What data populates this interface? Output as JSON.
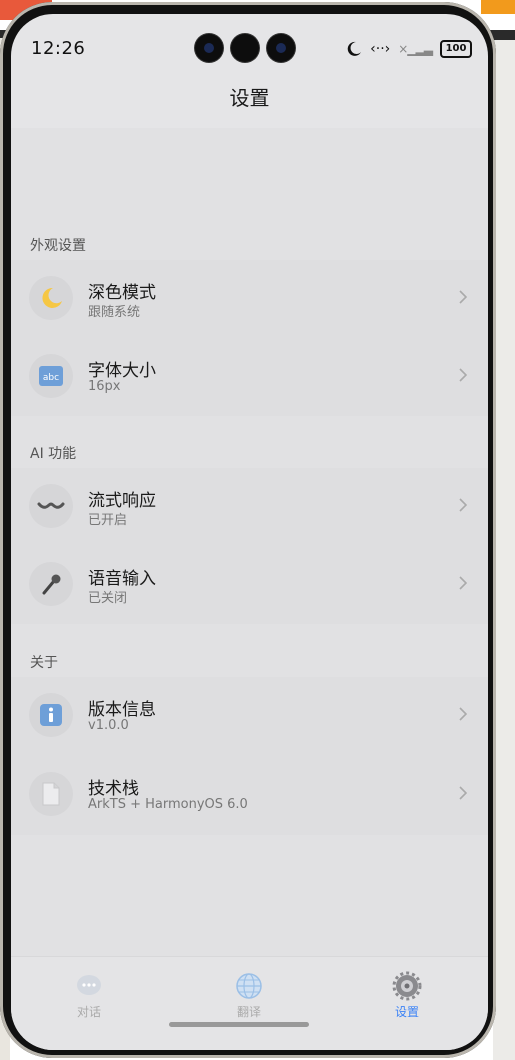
{
  "status_bar": {
    "time": "12:26",
    "battery": "100",
    "icons": [
      "moon-icon",
      "data-arrows-icon",
      "signal-icon",
      "battery-icon"
    ]
  },
  "nav": {
    "title": "设置"
  },
  "sections": [
    {
      "title": "外观设置",
      "items": [
        {
          "title": "深色模式",
          "subtitle": "跟随系统",
          "icon": "moon-icon"
        },
        {
          "title": "字体大小",
          "subtitle": "16px",
          "icon": "abc-icon"
        }
      ]
    },
    {
      "title": "AI 功能",
      "items": [
        {
          "title": "流式响应",
          "subtitle": "已开启",
          "icon": "wave-icon"
        },
        {
          "title": "语音输入",
          "subtitle": "已关闭",
          "icon": "microphone-icon"
        }
      ]
    },
    {
      "title": "关于",
      "items": [
        {
          "title": "版本信息",
          "subtitle": "v1.0.0",
          "icon": "info-icon"
        },
        {
          "title": "技术栈",
          "subtitle": "ArkTS + HarmonyOS 6.0",
          "icon": "document-icon"
        }
      ]
    }
  ],
  "tabs": [
    {
      "label": "对话",
      "icon": "chat-bubble-icon",
      "active": false
    },
    {
      "label": "翻译",
      "icon": "globe-icon",
      "active": false
    },
    {
      "label": "设置",
      "icon": "gear-icon",
      "active": true
    }
  ],
  "colors": {
    "accent": "#3b82f6",
    "background": "#e1e1e3",
    "card": "#dedee0"
  }
}
